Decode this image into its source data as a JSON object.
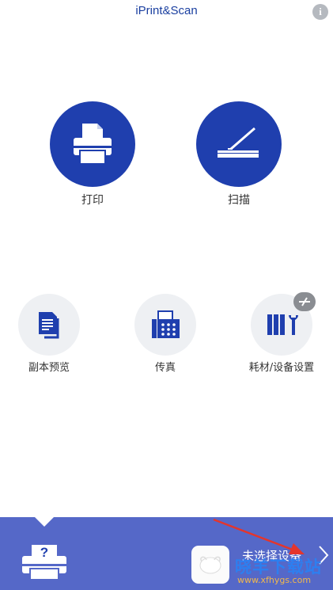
{
  "header": {
    "title": "iPrint&Scan",
    "info_icon": "info-icon"
  },
  "main_actions": [
    {
      "label": "打印",
      "icon": "printer-icon"
    },
    {
      "label": "扫描",
      "icon": "scanner-icon"
    }
  ],
  "secondary_actions": [
    {
      "label": "副本预览",
      "icon": "copy-preview-icon"
    },
    {
      "label": "传真",
      "icon": "fax-icon"
    },
    {
      "label": "耗材/设备设置",
      "icon": "supplies-settings-icon",
      "badge_icon": "offline-icon"
    }
  ],
  "bottom_bar": {
    "device_icon": "unknown-printer-icon",
    "device_icon_glyph": "?",
    "status": "未选择设备",
    "chevron_icon": "chevron-right-icon"
  },
  "watermark": {
    "text": "晓羊下载站",
    "url": "www.xfhygs.com"
  },
  "colors": {
    "primary": "#1f3fae",
    "bottom_bar": "#5568c8",
    "light_circle": "#eef0f3",
    "title": "#1a3fa0"
  }
}
